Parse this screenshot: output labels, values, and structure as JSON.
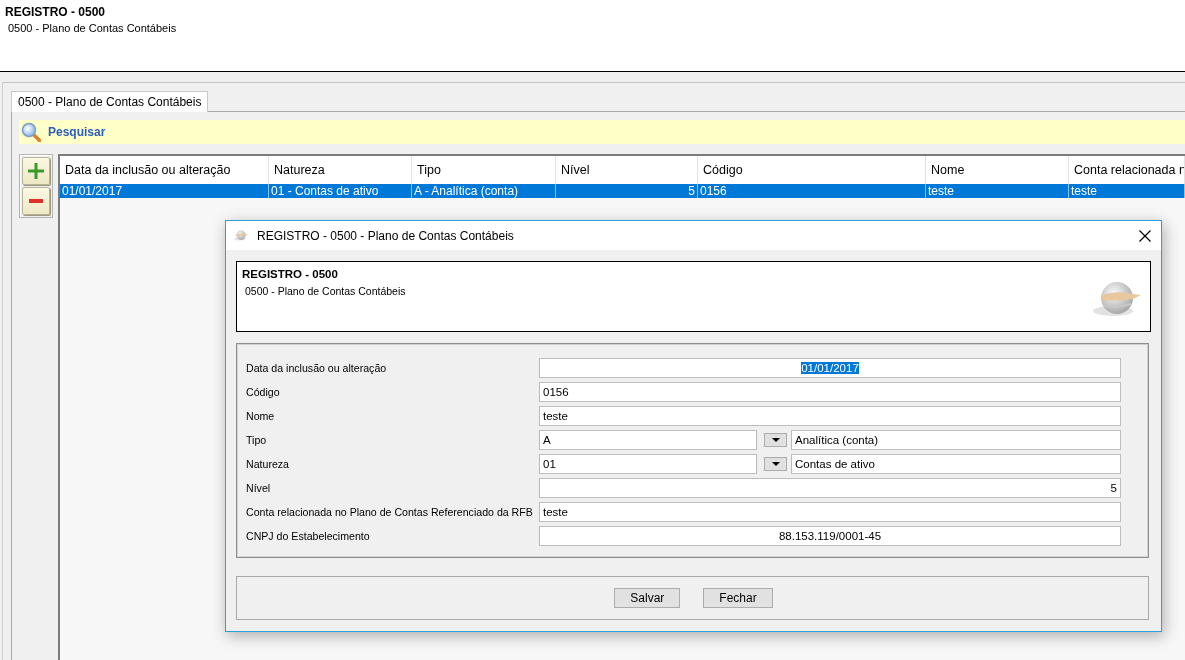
{
  "header": {
    "title": "REGISTRO - 0500",
    "subtitle": "0500 - Plano de Contas Contábeis"
  },
  "tabs": [
    {
      "label": "0500 - Plano de Contas Contábeis",
      "selected": true
    }
  ],
  "search_bar": {
    "label": "Pesquisar"
  },
  "side_buttons": [
    {
      "kind": "add"
    },
    {
      "kind": "remove"
    }
  ],
  "table": {
    "columns": [
      {
        "label": "Data da inclusão ou alteração",
        "kind": "text"
      },
      {
        "label": "Natureza",
        "kind": "text"
      },
      {
        "label": "Tipo",
        "kind": "text"
      },
      {
        "label": "Nível",
        "kind": "number"
      },
      {
        "label": "Código",
        "kind": "text"
      },
      {
        "label": "Nome",
        "kind": "text"
      },
      {
        "label": "Conta relacionada n",
        "kind": "text"
      }
    ],
    "rows": [
      {
        "selected": true,
        "cells": [
          "01/01/2017",
          "01 - Contas de ativo",
          "A - Analítica (conta)",
          "5",
          "0156",
          "teste",
          "teste"
        ]
      }
    ]
  },
  "dialog": {
    "title": "REGISTRO - 0500 - Plano de Contas Contábeis",
    "header": {
      "title": "REGISTRO - 0500",
      "subtitle": "0500 - Plano de Contas Contábeis"
    },
    "fields": [
      {
        "label": "Data da inclusão ou alteração",
        "kind": "date",
        "value": "01/01/2017",
        "value_selected": true
      },
      {
        "label": "Código",
        "kind": "text",
        "value": "0156",
        "value_selected": false
      },
      {
        "label": "Nome",
        "kind": "text",
        "value": "teste",
        "value_selected": false
      },
      {
        "label": "Tipo",
        "kind": "lookup",
        "value": "A",
        "description": "Analítica (conta)",
        "value_selected": false
      },
      {
        "label": "Natureza",
        "kind": "lookup",
        "value": "01",
        "description": "Contas de ativo",
        "value_selected": false
      },
      {
        "label": "Nível",
        "kind": "number",
        "value": "5",
        "value_selected": false
      },
      {
        "label": "Conta relacionada no Plano de Contas Referenciado da RFB",
        "kind": "text",
        "value": "teste",
        "value_selected": false
      },
      {
        "label": "CNPJ do Estabelecimento",
        "kind": "document",
        "value": "88.153.119/0001-45",
        "value_selected": false
      }
    ],
    "buttons": [
      "Salvar",
      "Fechar"
    ]
  }
}
